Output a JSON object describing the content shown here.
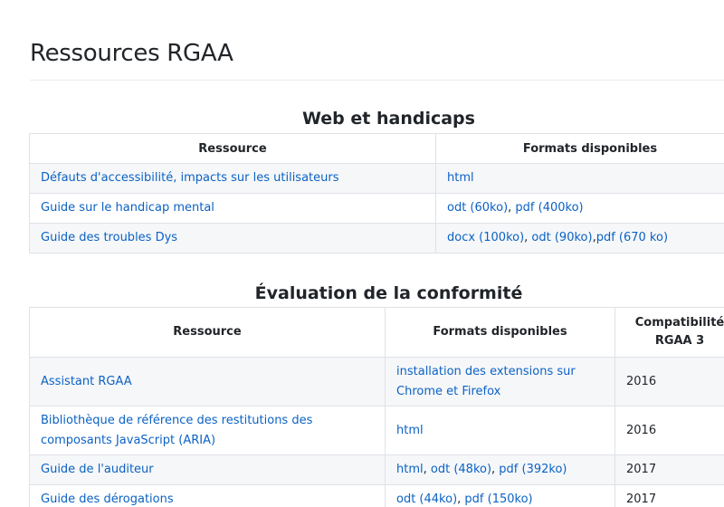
{
  "page": {
    "title": "Ressources RGAA"
  },
  "web_handicaps": {
    "title": "Web et handicaps",
    "headers": [
      "Ressource",
      "Formats disponibles"
    ],
    "rows": [
      {
        "resource": "Défauts d'accessibilité, impacts sur les utilisateurs",
        "formats": [
          "html"
        ]
      },
      {
        "resource": "Guide sur le handicap mental",
        "formats": [
          "odt (60ko)",
          "pdf (400ko)"
        ]
      },
      {
        "resource": "Guide des troubles Dys",
        "formats": [
          "docx (100ko)",
          "odt (90ko)",
          "pdf (670 ko)"
        ]
      }
    ]
  },
  "evaluation": {
    "title": "Évaluation de la conformité",
    "headers": [
      "Ressource",
      "Formats disponibles",
      "Compatibilité RGAA 3"
    ],
    "rows": [
      {
        "resource": "Assistant RGAA",
        "formats": [
          "installation des extensions sur Chrome et Firefox"
        ],
        "compat": "2016"
      },
      {
        "resource": "Bibliothèque de référence des restitutions des composants JavaScript (ARIA)",
        "formats": [
          "html"
        ],
        "compat": "2016"
      },
      {
        "resource": "Guide de l'auditeur",
        "formats": [
          "html",
          "odt (48ko)",
          "pdf (392ko)"
        ],
        "compat": "2017"
      },
      {
        "resource": "Guide des dérogations",
        "formats": [
          "odt (44ko)",
          "pdf (150ko)"
        ],
        "compat": "2017"
      }
    ]
  }
}
